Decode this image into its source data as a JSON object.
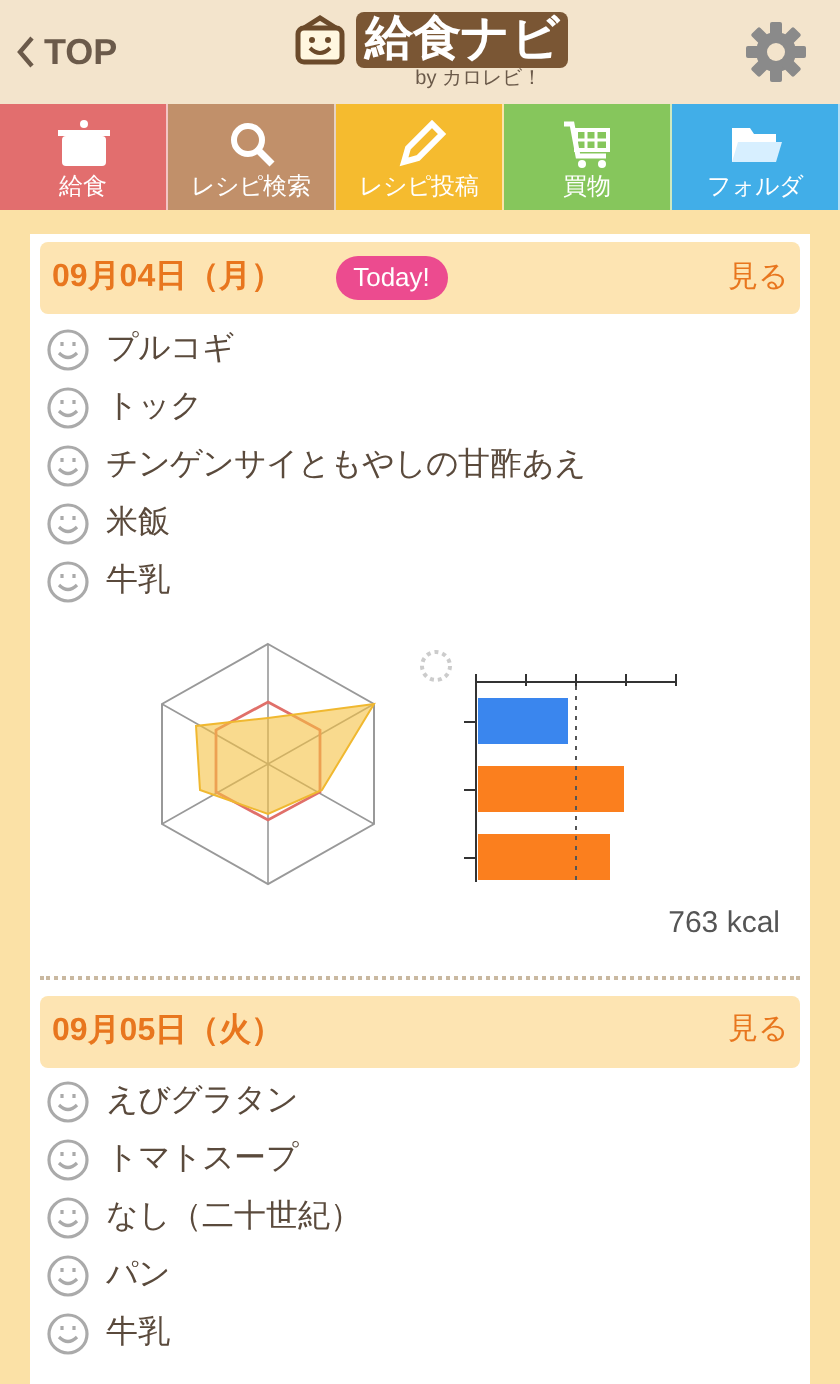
{
  "header": {
    "back": "TOP",
    "logo": "給食ナビ",
    "byline": "by カロレビ！"
  },
  "tabs": [
    {
      "label": "給食",
      "color": "#e26e6e"
    },
    {
      "label": "レシピ検索",
      "color": "#c1906a"
    },
    {
      "label": "レシピ投稿",
      "color": "#f5bb2f"
    },
    {
      "label": "買物",
      "color": "#86c65c"
    },
    {
      "label": "フォルダ",
      "color": "#41aee8"
    }
  ],
  "days": [
    {
      "date": "09月04日（月）",
      "today": true,
      "badge": "Today!",
      "link": "見る",
      "dishes": [
        "プルコギ",
        "トック",
        "チンゲンサイともやしの甘酢あえ",
        "米飯",
        "牛乳"
      ],
      "charts": true,
      "kcal": "763 kcal"
    },
    {
      "date": "09月05日（火）",
      "today": false,
      "link": "見る",
      "dishes": [
        "えびグラタン",
        "トマトスープ",
        "なし（二十世紀）",
        "パン",
        "牛乳"
      ],
      "charts": false
    }
  ]
}
